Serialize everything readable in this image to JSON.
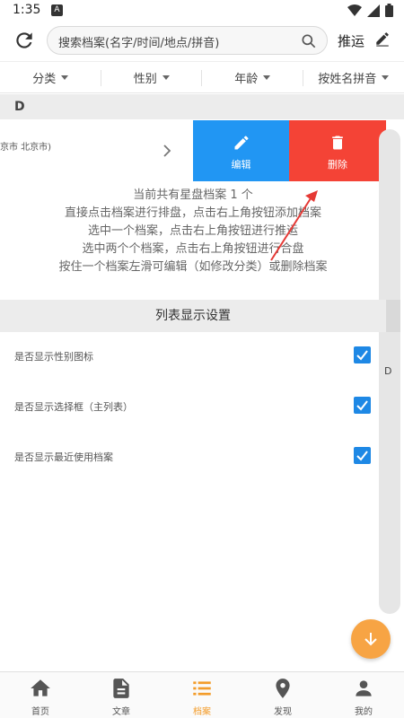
{
  "status": {
    "time": "1:35",
    "notif_letter": "A"
  },
  "toolbar": {
    "search_placeholder": "搜索档案(名字/时间/地点/拼音)",
    "push_label": "推运"
  },
  "filters": [
    "分类",
    "性别",
    "年龄",
    "按姓名拼音"
  ],
  "section_letter": "D",
  "record": {
    "location_text": "京市 北京市)"
  },
  "swipe_actions": {
    "edit_label": "编辑",
    "delete_label": "删除"
  },
  "info_lines": [
    "当前共有星盘档案 1 个",
    "直接点击档案进行排盘，点击右上角按钮添加档案",
    "选中一个档案，点击右上角按钮进行推运",
    "选中两个个档案，点击右上角按钮进行合盘",
    "按住一个档案左滑可编辑（如修改分类）或删除档案"
  ],
  "settings": {
    "header": "列表显示设置",
    "items": [
      {
        "label": "是否显示性别图标",
        "checked": true
      },
      {
        "label": "是否显示选择框（主列表）",
        "checked": true
      },
      {
        "label": "是否显示最近使用档案",
        "checked": true
      }
    ]
  },
  "index_letter": "D",
  "bottom_nav": [
    {
      "label": "首页",
      "icon": "home-icon",
      "active": false
    },
    {
      "label": "文章",
      "icon": "article-icon",
      "active": false
    },
    {
      "label": "档案",
      "icon": "list-icon",
      "active": true
    },
    {
      "label": "发现",
      "icon": "location-pin-icon",
      "active": false
    },
    {
      "label": "我的",
      "icon": "person-icon",
      "active": false
    }
  ],
  "colors": {
    "edit": "#2196f3",
    "delete": "#f44336",
    "accent": "#f39c2a",
    "checkbox": "#1e88e5"
  }
}
